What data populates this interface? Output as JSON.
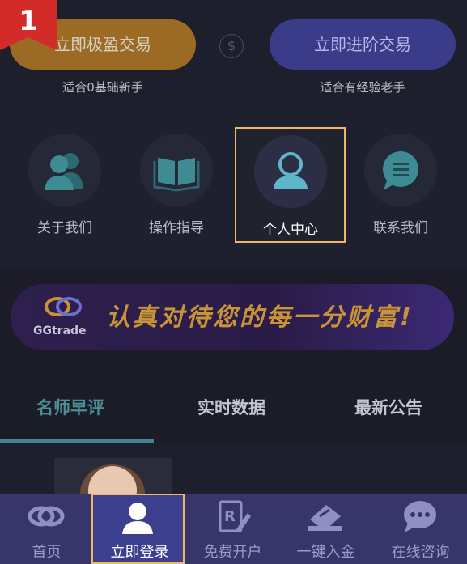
{
  "step_badge": "1",
  "trade": {
    "left_button": "立即极盈交易",
    "left_sub": "适合0基础新手",
    "right_button": "立即进阶交易",
    "right_sub": "适合有经验老手",
    "coin_symbol": "$"
  },
  "quick_links": [
    {
      "label": "关于我们",
      "icon": "people-icon"
    },
    {
      "label": "操作指导",
      "icon": "book-icon"
    },
    {
      "label": "个人中心",
      "icon": "user-icon"
    },
    {
      "label": "联系我们",
      "icon": "chat-icon"
    }
  ],
  "banner": {
    "brand": "GGtrade",
    "slogan": "认真对待您的每一分财富!"
  },
  "tabs": [
    "名师早评",
    "实时数据",
    "最新公告"
  ],
  "bottom_nav": [
    {
      "label": "首页",
      "icon": "home-logo-icon"
    },
    {
      "label": "立即登录",
      "icon": "user-icon"
    },
    {
      "label": "免费开户",
      "icon": "register-icon"
    },
    {
      "label": "一键入金",
      "icon": "deposit-icon"
    },
    {
      "label": "在线咨询",
      "icon": "chat-icon"
    }
  ],
  "colors": {
    "accent_gold": "#9b6b26",
    "accent_blue": "#3a3c8a",
    "highlight_border": "#f2b66a",
    "tab_active": "#4a8e96"
  }
}
